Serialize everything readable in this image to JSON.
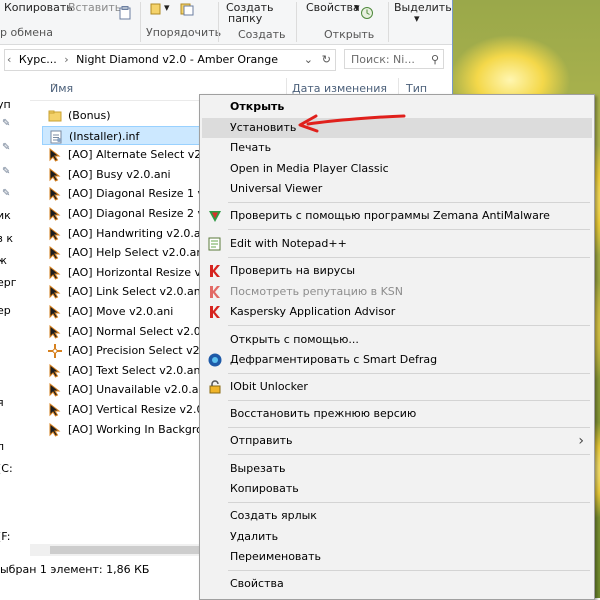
{
  "ribbon": {
    "copy": "Копировать",
    "paste": "Вставить",
    "clipboard_group": "р обмена",
    "organize_group": "Упорядочить",
    "new_folder_line1": "Создать",
    "new_folder_line2": "папку",
    "create_group": "Создать",
    "properties": "Свойства",
    "open_group": "Открыть",
    "select": "Выделить"
  },
  "address": {
    "back": "‹",
    "crumb1": "Курс...",
    "sep": "›",
    "crumb2": "Night Diamond v2.0 - Amber Orange",
    "search_placeholder": "Поиск: Ni..."
  },
  "left_pane": {
    "items": [
      "уп",
      "ик",
      "з к",
      "ж",
      "ерг",
      "ер",
      "я",
      "л",
      "(C:",
      "(F:"
    ]
  },
  "columns": {
    "name": "Имя",
    "date": "Дата изменения",
    "type": "Тип"
  },
  "files": [
    {
      "name": "(Bonus)",
      "icon": "folder-icon"
    },
    {
      "name": "(Installer).inf",
      "icon": "inf-file-icon"
    },
    {
      "name": "[AO] Alternate Select v2.0",
      "icon": "cursor-icon"
    },
    {
      "name": "[AO] Busy v2.0.ani",
      "icon": "cursor-icon"
    },
    {
      "name": "[AO] Diagonal Resize 1 v2",
      "icon": "cursor-icon"
    },
    {
      "name": "[AO] Diagonal Resize 2 v2",
      "icon": "cursor-icon"
    },
    {
      "name": "[AO] Handwriting v2.0.ani",
      "icon": "cursor-icon"
    },
    {
      "name": "[AO] Help Select v2.0.ani",
      "icon": "cursor-icon"
    },
    {
      "name": "[AO] Horizontal Resize v2",
      "icon": "cursor-icon"
    },
    {
      "name": "[AO] Link Select v2.0.ani",
      "icon": "cursor-icon"
    },
    {
      "name": "[AO] Move v2.0.ani",
      "icon": "cursor-icon"
    },
    {
      "name": "[AO] Normal Select v2.0.ar",
      "icon": "cursor-icon"
    },
    {
      "name": "[AO] Precision Select v2.0",
      "icon": "crosshair-icon"
    },
    {
      "name": "[AO] Text Select v2.0.ani",
      "icon": "cursor-icon"
    },
    {
      "name": "[AO] Unavailable v2.0.ani",
      "icon": "cursor-icon"
    },
    {
      "name": "[AO] Vertical Resize v2.0.a",
      "icon": "cursor-icon"
    },
    {
      "name": "[AO] Working In Backgrou",
      "icon": "cursor-icon"
    }
  ],
  "status": "ыбран 1 элемент: 1,86 КБ",
  "menu": {
    "open": "Открыть",
    "install": "Установить",
    "print": "Печать",
    "open_mpc": "Open in Media Player Classic",
    "universal_viewer": "Universal Viewer",
    "zemana": "Проверить с помощью программы Zemana AntiMalware",
    "notepad": "Edit with Notepad++",
    "check_virus": "Проверить на вирусы",
    "ksn": "Посмотреть репутацию в KSN",
    "kaspersky_advisor": "Kaspersky Application Advisor",
    "open_with": "Открыть с помощью...",
    "defrag": "Дефрагментировать с Smart Defrag",
    "unlocker": "IObit Unlocker",
    "restore": "Восстановить прежнюю версию",
    "send_to": "Отправить",
    "cut": "Вырезать",
    "copy": "Копировать",
    "shortcut": "Создать ярлык",
    "delete": "Удалить",
    "rename": "Переименовать",
    "properties": "Свойства"
  },
  "colors": {
    "selection_bg": "#cce8ff",
    "menu_bg": "#f2f2f2",
    "annotation_arrow": "#e0201c"
  }
}
